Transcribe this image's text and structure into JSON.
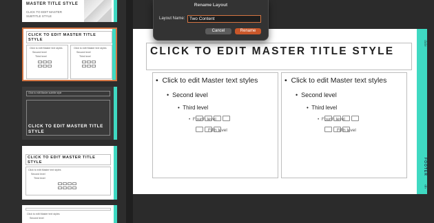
{
  "dialog": {
    "title": "Rename Layout",
    "label": "Layout Name:",
    "value": "Two Content",
    "cancel": "Cancel",
    "rename": "Rename",
    "accent": "#c9572a"
  },
  "slide": {
    "title": "CLICK TO EDIT MASTER TITLE STYLE",
    "left": {
      "l1": "Click to edit Master text styles",
      "l2": "Second level",
      "l3": "Third level",
      "l4": "Fourth level",
      "l5": "Fifth level"
    },
    "right": {
      "l1": "Click to edit Master text styles",
      "l2": "Second level",
      "l3": "Third level",
      "l4": "Fourth level",
      "l5": "Fifth level"
    },
    "footer": "FOOTER",
    "date": "date",
    "accent": "#3fd9c2"
  },
  "thumbs": {
    "t1": {
      "title": "MASTER TITLE STYLE",
      "subtitle": "CLICK TO EDIT MASTER SUBTITLE STYLE"
    },
    "t2": {
      "title": "CLICK TO EDIT MASTER TITLE STYLE",
      "l1": "Click to edit Master text styles",
      "l2": "Second level",
      "l3": "Third level"
    },
    "t3": {
      "top": "Click to edit Master subtitle style",
      "title": "CLICK TO EDIT MASTER TITLE STYLE"
    },
    "t4": {
      "title": "CLICK TO EDIT MASTER TITLE STYLE",
      "l1": "Click to edit Master text styles",
      "l2": "Second level",
      "l3": "Third level"
    },
    "t5": {
      "l1": "Click to edit Master text styles",
      "l2": "Second level"
    }
  }
}
